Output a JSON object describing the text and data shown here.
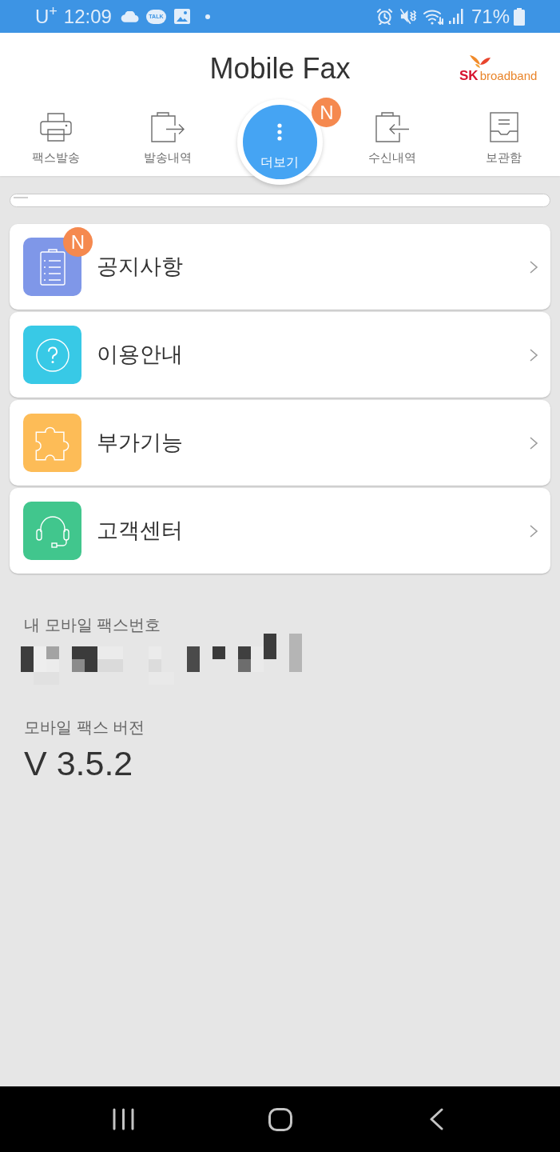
{
  "status_bar": {
    "carrier": "U$^{+}$",
    "time": "12:09",
    "chat_app_label": "TALK",
    "battery": "71%"
  },
  "header": {
    "title": "Mobile Fax",
    "logo": {
      "mark": "SK",
      "name": "broadband"
    }
  },
  "tabs": [
    {
      "kind": "send_fax",
      "label": "팩스발송",
      "selected": false
    },
    {
      "kind": "sent",
      "label": "발송내역",
      "selected": false
    },
    {
      "kind": "more",
      "label": "더보기",
      "selected": true,
      "badge": "N"
    },
    {
      "kind": "received",
      "label": "수신내역",
      "selected": false
    },
    {
      "kind": "archive",
      "label": "보관함",
      "selected": false
    }
  ],
  "menu": [
    {
      "kind": "notice",
      "label": "공지사항",
      "color": "#7f97e8",
      "badge": "N"
    },
    {
      "kind": "guide",
      "label": "이용안내",
      "color": "#38c9e6"
    },
    {
      "kind": "extras",
      "label": "부가기능",
      "color": "#fdbc57"
    },
    {
      "kind": "support",
      "label": "고객센터",
      "color": "#41c68d"
    }
  ],
  "fax_number": {
    "label": "내 모바일 팩스번호"
  },
  "version": {
    "label": "모바일 팩스 버전",
    "value": "V 3.5.2"
  }
}
